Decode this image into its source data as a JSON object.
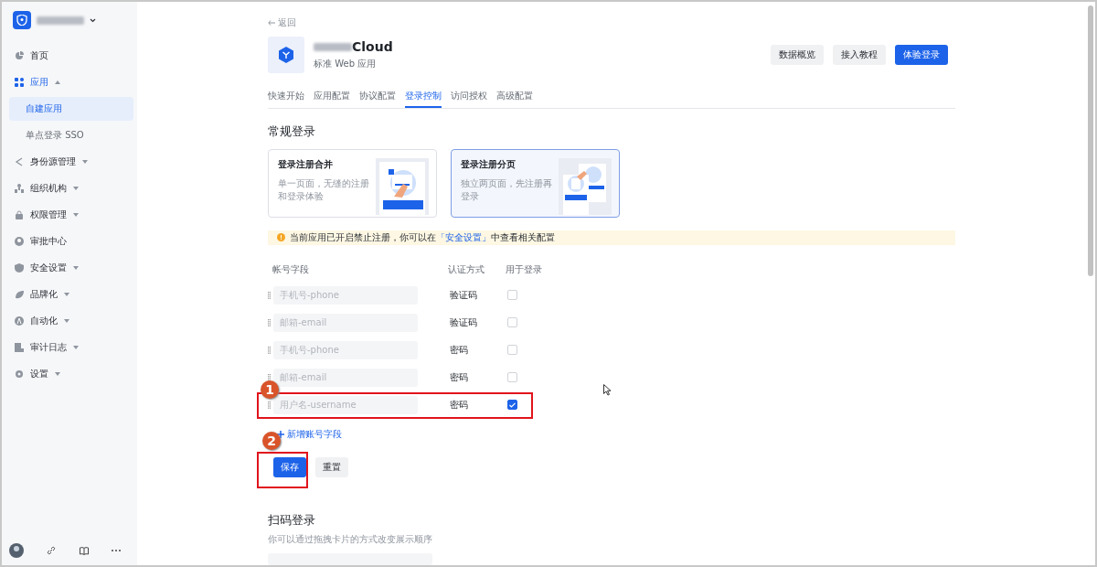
{
  "sidebar": {
    "nav": [
      {
        "label": "首页",
        "kind": "link"
      },
      {
        "label": "应用",
        "kind": "group",
        "expanded": true,
        "children": [
          {
            "label": "自建应用",
            "selected": true
          },
          {
            "label": "单点登录 SSO",
            "selected": false
          }
        ]
      },
      {
        "label": "身份源管理",
        "kind": "group",
        "expanded": false
      },
      {
        "label": "组织机构",
        "kind": "group",
        "expanded": false
      },
      {
        "label": "权限管理",
        "kind": "group",
        "expanded": false
      },
      {
        "label": "审批中心",
        "kind": "link"
      },
      {
        "label": "安全设置",
        "kind": "group",
        "expanded": false
      },
      {
        "label": "品牌化",
        "kind": "group",
        "expanded": false
      },
      {
        "label": "自动化",
        "kind": "group",
        "expanded": false
      },
      {
        "label": "审计日志",
        "kind": "group",
        "expanded": false
      },
      {
        "label": "设置",
        "kind": "group",
        "expanded": false
      }
    ]
  },
  "header": {
    "back": "返回",
    "app_name": "Cloud",
    "app_type": "标准 Web 应用",
    "buttons": [
      {
        "label": "数据概览",
        "primary": false
      },
      {
        "label": "接入教程",
        "primary": false
      },
      {
        "label": "体验登录",
        "primary": true
      }
    ]
  },
  "tabs": [
    {
      "label": "快速开始",
      "selected": false
    },
    {
      "label": "应用配置",
      "selected": false
    },
    {
      "label": "协议配置",
      "selected": false
    },
    {
      "label": "登录控制",
      "selected": true
    },
    {
      "label": "访问授权",
      "selected": false
    },
    {
      "label": "高级配置",
      "selected": false
    }
  ],
  "regular_login": {
    "title": "常规登录",
    "modes": [
      {
        "title": "登录注册合并",
        "description": "单一页面，无缝的注册和登录体验",
        "selected": false
      },
      {
        "title": "登录注册分页",
        "description": "独立两页面，先注册再登录",
        "selected": true
      }
    ],
    "notice": {
      "before": "当前应用已开启禁止注册，你可以在",
      "link": "「安全设置」",
      "after": "中查看相关配置"
    },
    "columns": [
      "帐号字段",
      "认证方式",
      "用于登录"
    ],
    "rows": [
      {
        "placeholder": "手机号-phone",
        "method": "验证码",
        "checked": false
      },
      {
        "placeholder": "邮箱-email",
        "method": "验证码",
        "checked": false
      },
      {
        "placeholder": "手机号-phone",
        "method": "密码",
        "checked": false
      },
      {
        "placeholder": "邮箱-email",
        "method": "密码",
        "checked": false
      },
      {
        "placeholder": "用户名-username",
        "method": "密码",
        "checked": true,
        "annotation": "1"
      }
    ],
    "add_field": "新增账号字段",
    "save": {
      "label": "保存",
      "annotation": "2"
    },
    "reset": "重置"
  },
  "qr_login": {
    "title": "扫码登录",
    "hint": "你可以通过拖拽卡片的方式改变展示顺序"
  }
}
